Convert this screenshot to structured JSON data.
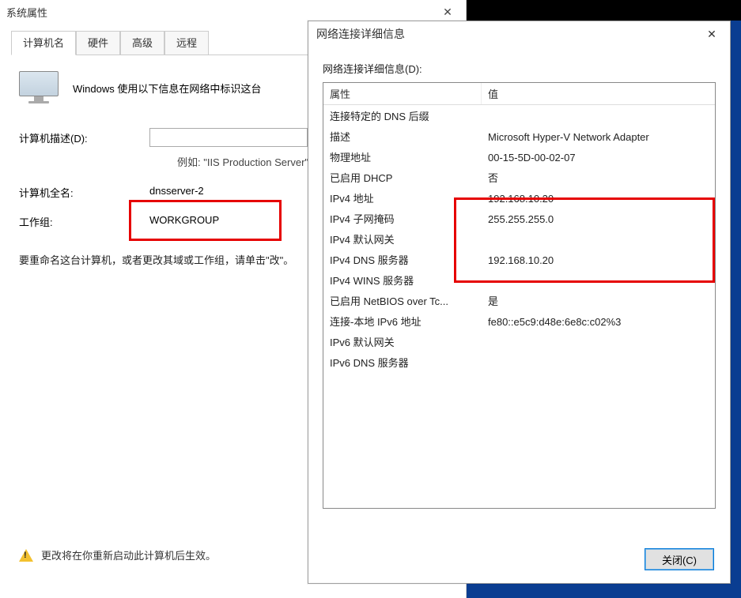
{
  "system_properties": {
    "title": "系统属性",
    "tabs": {
      "computer_name": "计算机名",
      "hardware": "硬件",
      "advanced": "高级",
      "remote": "远程"
    },
    "intro_text": "Windows 使用以下信息在网络中标识这台",
    "description_label": "计算机描述(D):",
    "description_value": "",
    "example_label": "例如: \"IIS Production Server\"",
    "fullname_label": "计算机全名:",
    "fullname_value": "dnsserver-2",
    "workgroup_label": "工作组:",
    "workgroup_value": "WORKGROUP",
    "rename_text": "要重命名这台计算机，或者更改其域或工作组，请单击\"改\"。",
    "restart_note": "更改将在你重新启动此计算机后生效。"
  },
  "network_details": {
    "title": "网络连接详细信息",
    "caption": "网络连接详细信息(D):",
    "col_property": "属性",
    "col_value": "值",
    "rows": [
      {
        "prop": "连接特定的 DNS 后缀",
        "val": ""
      },
      {
        "prop": "描述",
        "val": "Microsoft Hyper-V Network Adapter"
      },
      {
        "prop": "物理地址",
        "val": "00-15-5D-00-02-07"
      },
      {
        "prop": "已启用 DHCP",
        "val": "否"
      },
      {
        "prop": "IPv4 地址",
        "val": "192.168.10.20"
      },
      {
        "prop": "IPv4 子网掩码",
        "val": "255.255.255.0"
      },
      {
        "prop": "IPv4 默认网关",
        "val": ""
      },
      {
        "prop": "IPv4 DNS 服务器",
        "val": "192.168.10.20"
      },
      {
        "prop": "IPv4 WINS 服务器",
        "val": ""
      },
      {
        "prop": "已启用 NetBIOS over Tc...",
        "val": "是"
      },
      {
        "prop": "连接-本地 IPv6 地址",
        "val": "fe80::e5c9:d48e:6e8c:c02%3"
      },
      {
        "prop": "IPv6 默认网关",
        "val": ""
      },
      {
        "prop": "IPv6 DNS 服务器",
        "val": ""
      }
    ],
    "close_button": "关闭(C)"
  }
}
